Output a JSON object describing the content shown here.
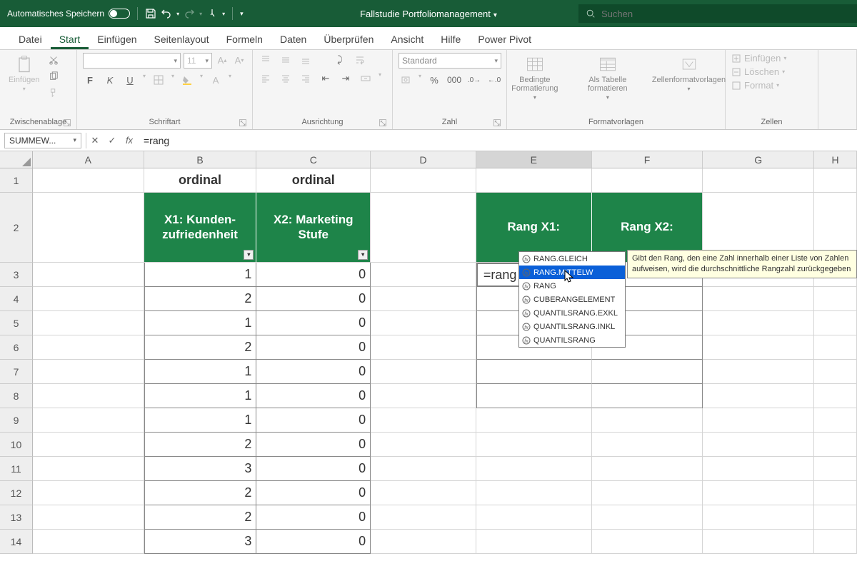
{
  "titlebar": {
    "autosave_label": "Automatisches Speichern",
    "doc_title": "Fallstudie Portfoliomanagement",
    "search_placeholder": "Suchen"
  },
  "ribbon_tabs": [
    "Datei",
    "Start",
    "Einfügen",
    "Seitenlayout",
    "Formeln",
    "Daten",
    "Überprüfen",
    "Ansicht",
    "Hilfe",
    "Power Pivot"
  ],
  "ribbon_active": 1,
  "groups": {
    "clipboard": {
      "label": "Zwischenablage",
      "paste": "Einfügen"
    },
    "font": {
      "label": "Schriftart",
      "size": "11",
      "bold": "F",
      "italic": "K",
      "underline": "U"
    },
    "alignment": {
      "label": "Ausrichtung"
    },
    "number": {
      "label": "Zahl",
      "format": "Standard"
    },
    "styles": {
      "label": "Formatvorlagen",
      "cond": "Bedingte Formatierung",
      "table": "Als Tabelle formatieren",
      "cell": "Zellenformatvorlagen"
    },
    "cells": {
      "label": "Zellen",
      "insert": "Einfügen",
      "delete": "Löschen",
      "format": "Format"
    }
  },
  "namebox": "SUMMEW...",
  "formula": "=rang",
  "columns": [
    "A",
    "B",
    "C",
    "D",
    "E",
    "F",
    "G",
    "H"
  ],
  "row1": {
    "B": "ordinal",
    "C": "ordinal"
  },
  "row2": {
    "B": "X1: Kunden-zufriedenheit",
    "C": "X2: Marketing Stufe",
    "E": "Rang X1:",
    "F": "Rang X2:"
  },
  "data_rows": [
    {
      "n": 3,
      "B": "1",
      "C": "0",
      "E": "=rang"
    },
    {
      "n": 4,
      "B": "2",
      "C": "0"
    },
    {
      "n": 5,
      "B": "1",
      "C": "0"
    },
    {
      "n": 6,
      "B": "2",
      "C": "0"
    },
    {
      "n": 7,
      "B": "1",
      "C": "0"
    },
    {
      "n": 8,
      "B": "1",
      "C": "0"
    },
    {
      "n": 9,
      "B": "1",
      "C": "0"
    },
    {
      "n": 10,
      "B": "2",
      "C": "0"
    },
    {
      "n": 11,
      "B": "3",
      "C": "0"
    },
    {
      "n": 12,
      "B": "2",
      "C": "0"
    },
    {
      "n": 13,
      "B": "2",
      "C": "0"
    },
    {
      "n": 14,
      "B": "3",
      "C": "0"
    }
  ],
  "autocomplete": [
    "RANG.GLEICH",
    "RANG.MITTELW",
    "RANG",
    "CUBERANGELEMENT",
    "QUANTILSRANG.EXKL",
    "QUANTILSRANG.INKL",
    "QUANTILSRANG"
  ],
  "autocomplete_selected": 1,
  "tooltip": "Gibt den Rang, den eine Zahl innerhalb einer Liste von Zahlen aufweisen, wird die durchschnittliche Rangzahl zurückgegeben"
}
